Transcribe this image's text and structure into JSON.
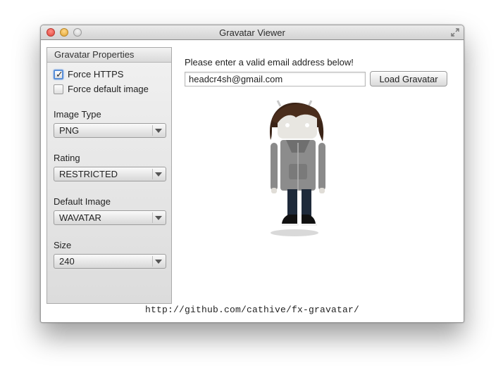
{
  "window": {
    "title": "Gravatar Viewer"
  },
  "sidebar": {
    "header": "Gravatar Properties",
    "force_https": {
      "label": "Force HTTPS",
      "checked": true
    },
    "force_default": {
      "label": "Force default image",
      "checked": false
    },
    "image_type": {
      "label": "Image Type",
      "value": "PNG"
    },
    "rating": {
      "label": "Rating",
      "value": "RESTRICTED"
    },
    "default_image": {
      "label": "Default Image",
      "value": "WAVATAR"
    },
    "size": {
      "label": "Size",
      "value": "240"
    }
  },
  "main": {
    "prompt": "Please enter a valid email address below!",
    "email_value": "headcr4sh@gmail.com",
    "load_button": "Load Gravatar",
    "avatar_icon": "android-gravatar-image"
  },
  "footer": {
    "link": "http://github.com/cathive/fx-gravatar/"
  },
  "colors": {
    "accent": "#5a8fd8",
    "close": "#e0443b",
    "minimize": "#e0a32d"
  }
}
